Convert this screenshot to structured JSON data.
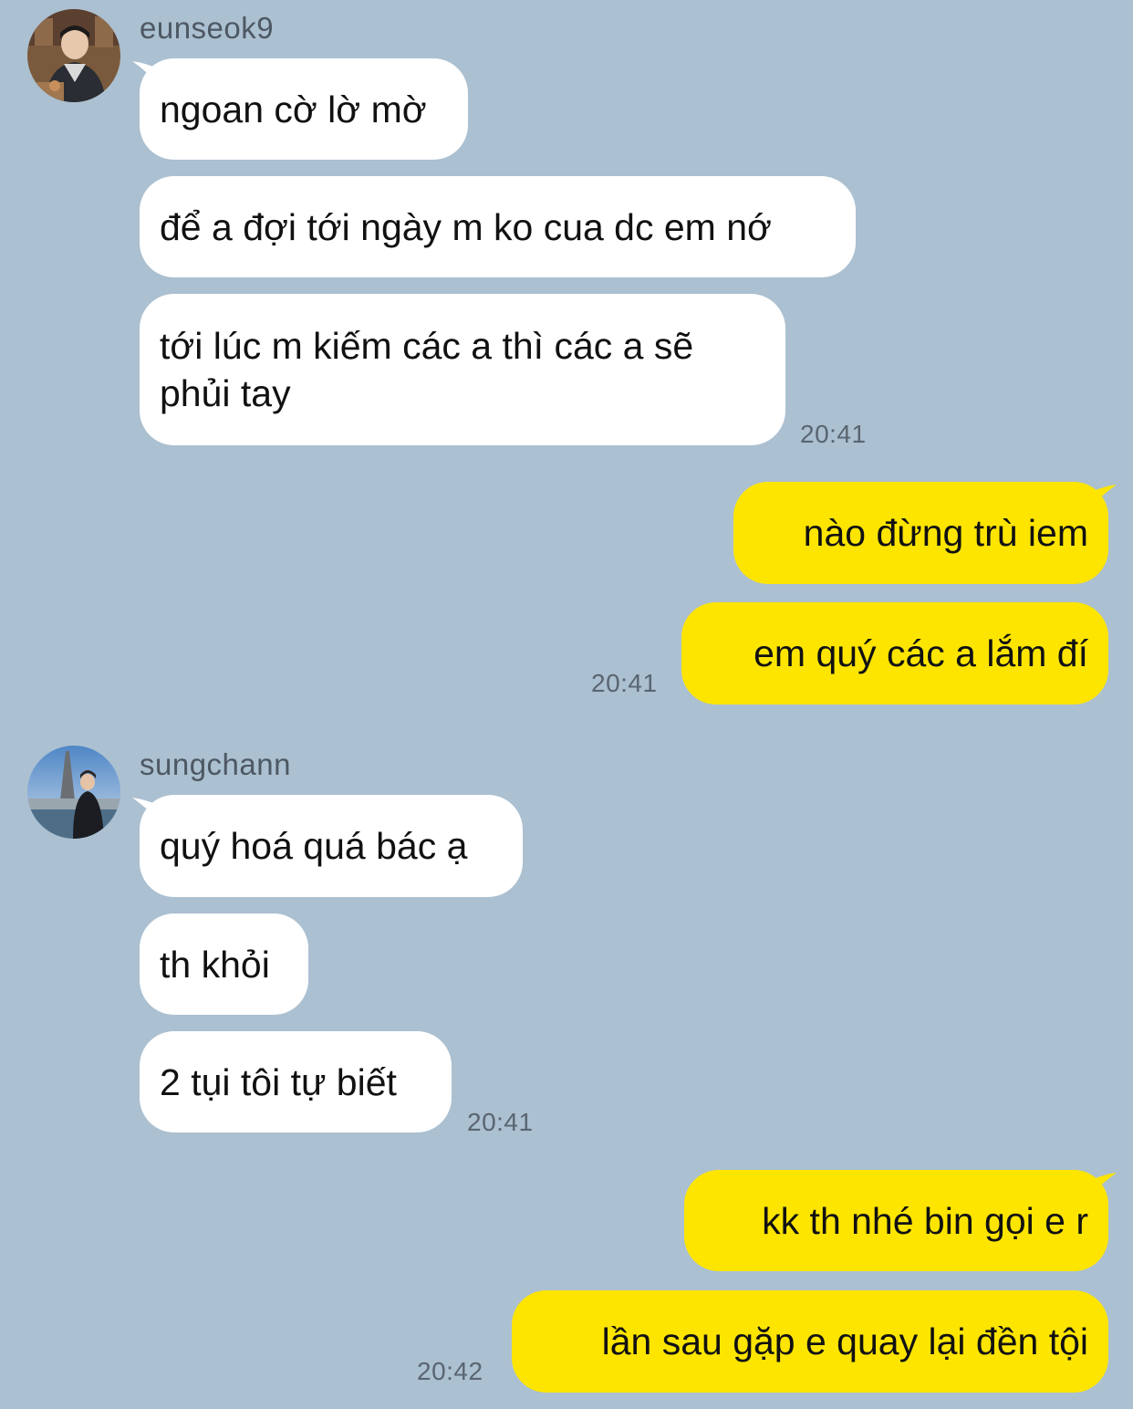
{
  "conversation": {
    "group1": {
      "sender": "eunseok9",
      "avatar_icon": "profile-photo-icon",
      "messages": [
        "ngoan cờ lờ mờ",
        "để a đợi tới ngày m ko cua dc em nớ",
        "tới lúc m kiếm các a thì các a sẽ phủi tay"
      ],
      "time": "20:41"
    },
    "group2": {
      "sender": "me",
      "messages": [
        "nào đừng trù iem",
        "em quý các a lắm đí"
      ],
      "time": "20:41"
    },
    "group3": {
      "sender": "sungchann",
      "avatar_icon": "profile-photo-icon",
      "messages": [
        "quý hoá quá bác ạ",
        "th khỏi",
        "2 tụi tôi tự biết"
      ],
      "time": "20:41"
    },
    "group4": {
      "sender": "me",
      "messages": [
        "kk th nhé bin gọi e r",
        "lần sau gặp e quay lại đền tội"
      ],
      "time": "20:42"
    }
  },
  "colors": {
    "background": "#abc0d1",
    "incoming_bubble": "#ffffff",
    "outgoing_bubble": "#fee500",
    "timestamp": "#5a6570"
  }
}
